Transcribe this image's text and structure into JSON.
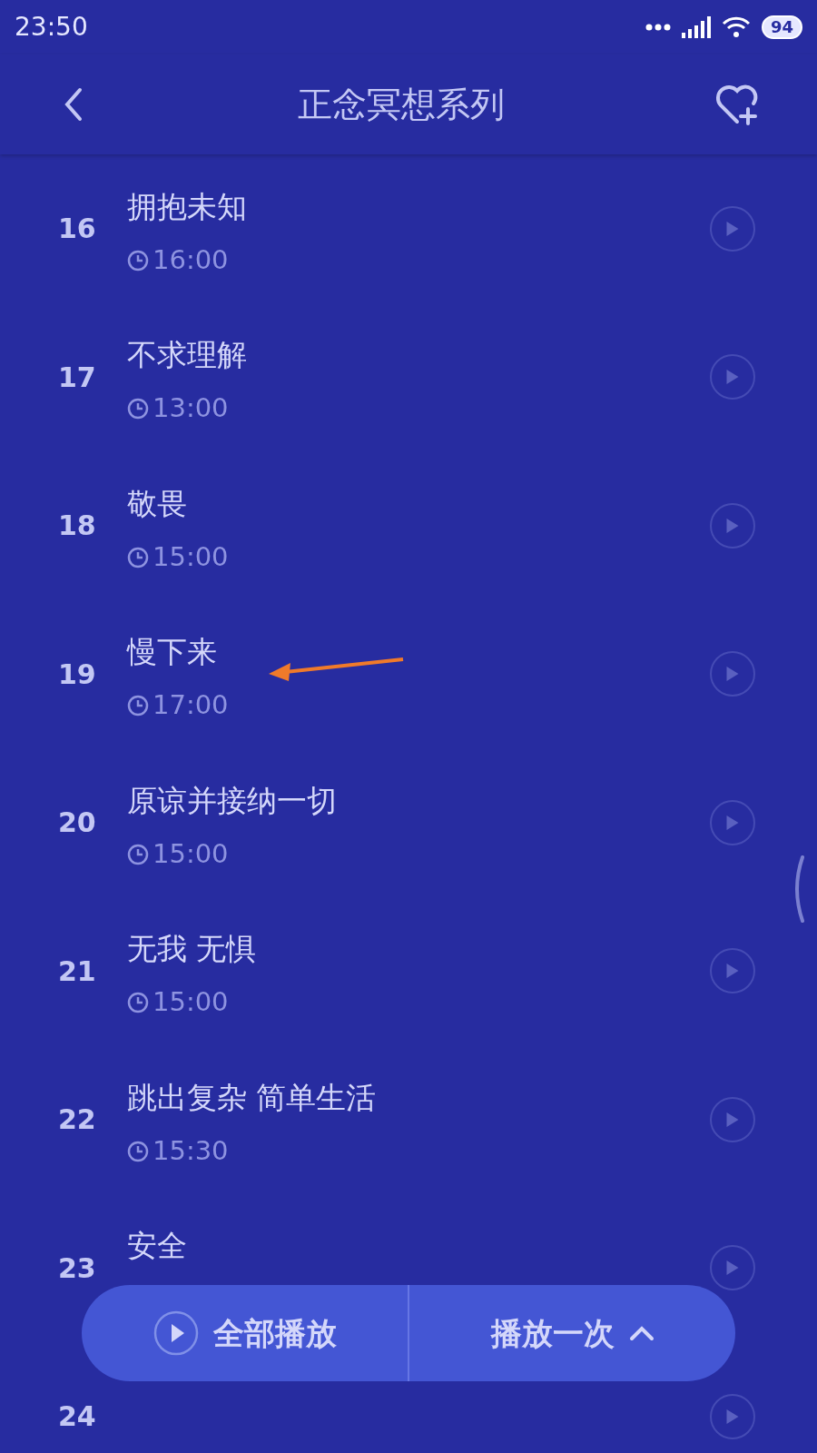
{
  "status_bar": {
    "time": "23:50",
    "battery": "94"
  },
  "header": {
    "title": "正念冥想系列"
  },
  "tracks": [
    {
      "number": "16",
      "title": "拥抱未知",
      "duration": "16:00"
    },
    {
      "number": "17",
      "title": "不求理解",
      "duration": "13:00"
    },
    {
      "number": "18",
      "title": "敬畏",
      "duration": "15:00"
    },
    {
      "number": "19",
      "title": "慢下来",
      "duration": "17:00"
    },
    {
      "number": "20",
      "title": "原谅并接纳一切",
      "duration": "15:00"
    },
    {
      "number": "21",
      "title": "无我 无惧",
      "duration": "15:00"
    },
    {
      "number": "22",
      "title": "跳出复杂 简单生活",
      "duration": "15:30"
    },
    {
      "number": "23",
      "title": "安全"
    },
    {
      "number": "24"
    }
  ],
  "player_bar": {
    "play_all": "全部播放",
    "mode": "播放一次"
  }
}
